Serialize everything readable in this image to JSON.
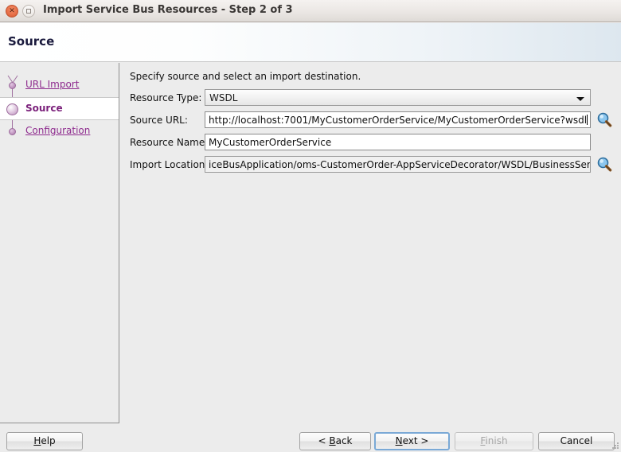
{
  "window": {
    "title": "Import Service Bus Resources - Step 2 of 3",
    "close_icon": "close-icon",
    "maximize_icon": "maximize-icon"
  },
  "header": {
    "title": "Source"
  },
  "sidebar": {
    "steps": [
      {
        "label": "URL Import",
        "state": "link"
      },
      {
        "label": "Source",
        "state": "current"
      },
      {
        "label": "Configuration",
        "state": "link"
      }
    ]
  },
  "main": {
    "instruction": "Specify source and select an import destination.",
    "fields": [
      {
        "label": "Resource Type:",
        "type": "combobox",
        "value": "WSDL",
        "arrow_icon": "chevron-down-icon"
      },
      {
        "label": "Source URL:",
        "type": "text",
        "value": "http://localhost:7001/MyCustomerOrderService/MyCustomerOrderService?wsdl",
        "browse_icon": "search-icon"
      },
      {
        "label": "Resource Name:",
        "type": "text",
        "value": "MyCustomerOrderService"
      },
      {
        "label": "Import Location:",
        "type": "text",
        "value": "iceBusApplication/oms-CustomerOrder-AppServiceDecorator/WSDL/BusinessService",
        "browse_icon": "search-icon"
      }
    ]
  },
  "footer": {
    "help": {
      "label": "Help",
      "mnemonic": "H"
    },
    "back": {
      "label": "< Back",
      "mnemonic": "B"
    },
    "next": {
      "label": "Next >",
      "mnemonic": "N"
    },
    "finish": {
      "label": "Finish",
      "mnemonic": "F",
      "enabled": false
    },
    "cancel": {
      "label": "Cancel"
    }
  },
  "colors": {
    "accent_link": "#8e2b8e",
    "header_title": "#1a1a3d",
    "focus_ring": "#7aa9d6",
    "close_button": "#e8714a"
  }
}
